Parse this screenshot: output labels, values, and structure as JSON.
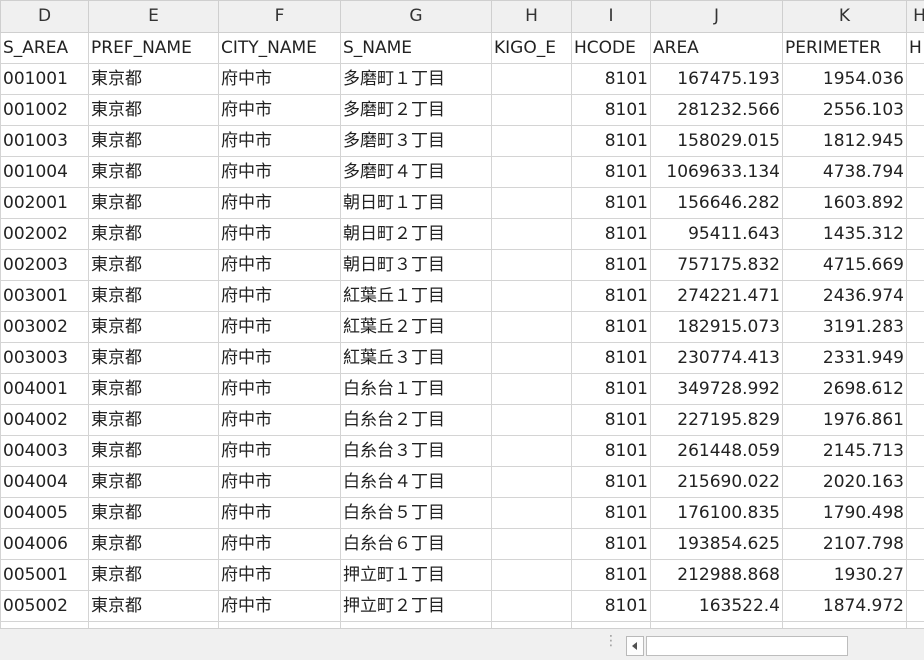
{
  "columns": [
    "",
    "D",
    "E",
    "F",
    "G",
    "H",
    "I",
    "J",
    "K",
    "H"
  ],
  "fields": [
    "",
    "S_AREA",
    "PREF_NAME",
    "CITY_NAME",
    "S_NAME",
    "KIGO_E",
    "HCODE",
    "AREA",
    "PERIMETER",
    "H"
  ],
  "rows": [
    [
      "001001",
      "東京都",
      "府中市",
      "多磨町１丁目",
      "",
      "8101",
      "167475.193",
      "1954.036"
    ],
    [
      "001002",
      "東京都",
      "府中市",
      "多磨町２丁目",
      "",
      "8101",
      "281232.566",
      "2556.103"
    ],
    [
      "001003",
      "東京都",
      "府中市",
      "多磨町３丁目",
      "",
      "8101",
      "158029.015",
      "1812.945"
    ],
    [
      "001004",
      "東京都",
      "府中市",
      "多磨町４丁目",
      "",
      "8101",
      "1069633.134",
      "4738.794"
    ],
    [
      "002001",
      "東京都",
      "府中市",
      "朝日町１丁目",
      "",
      "8101",
      "156646.282",
      "1603.892"
    ],
    [
      "002002",
      "東京都",
      "府中市",
      "朝日町２丁目",
      "",
      "8101",
      "95411.643",
      "1435.312"
    ],
    [
      "002003",
      "東京都",
      "府中市",
      "朝日町３丁目",
      "",
      "8101",
      "757175.832",
      "4715.669"
    ],
    [
      "003001",
      "東京都",
      "府中市",
      "紅葉丘１丁目",
      "",
      "8101",
      "274221.471",
      "2436.974"
    ],
    [
      "003002",
      "東京都",
      "府中市",
      "紅葉丘２丁目",
      "",
      "8101",
      "182915.073",
      "3191.283"
    ],
    [
      "003003",
      "東京都",
      "府中市",
      "紅葉丘３丁目",
      "",
      "8101",
      "230774.413",
      "2331.949"
    ],
    [
      "004001",
      "東京都",
      "府中市",
      "白糸台１丁目",
      "",
      "8101",
      "349728.992",
      "2698.612"
    ],
    [
      "004002",
      "東京都",
      "府中市",
      "白糸台２丁目",
      "",
      "8101",
      "227195.829",
      "1976.861"
    ],
    [
      "004003",
      "東京都",
      "府中市",
      "白糸台３丁目",
      "",
      "8101",
      "261448.059",
      "2145.713"
    ],
    [
      "004004",
      "東京都",
      "府中市",
      "白糸台４丁目",
      "",
      "8101",
      "215690.022",
      "2020.163"
    ],
    [
      "004005",
      "東京都",
      "府中市",
      "白糸台５丁目",
      "",
      "8101",
      "176100.835",
      "1790.498"
    ],
    [
      "004006",
      "東京都",
      "府中市",
      "白糸台６丁目",
      "",
      "8101",
      "193854.625",
      "2107.798"
    ],
    [
      "005001",
      "東京都",
      "府中市",
      "押立町１丁目",
      "",
      "8101",
      "212988.868",
      "1930.27"
    ],
    [
      "005002",
      "東京都",
      "府中市",
      "押立町２丁目",
      "",
      "8101",
      "163522.4",
      "1874.972"
    ],
    [
      "",
      "",
      "",
      "",
      "",
      "",
      "",
      ""
    ]
  ]
}
